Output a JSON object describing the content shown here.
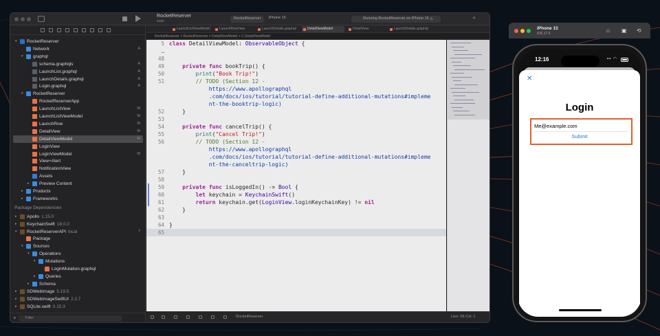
{
  "xcode": {
    "project_name": "RocketReserver",
    "branch": "main",
    "scheme": "RocketReserver",
    "device": "iPhone 15",
    "status": "Running RocketReserver on iPhone 15",
    "tabs": [
      "LaunchListViewModel",
      "LaunchRowView",
      "LaunchDetails.graphql",
      "DetailViewModel",
      "DetailView",
      "LaunchDetails.graphql"
    ],
    "jumpbar": "RocketReserver > RocketReserver > DetailViewModel > C DetailViewModel",
    "navigator": [
      {
        "label": "RocketReserver",
        "indent": 0,
        "icon": "proj",
        "disclosure": "▾"
      },
      {
        "label": "Network",
        "indent": 1,
        "icon": "folder",
        "tag": "A"
      },
      {
        "label": "graphql",
        "indent": 1,
        "icon": "folder",
        "disclosure": "▾"
      },
      {
        "label": "schema.graphqls",
        "indent": 2,
        "icon": "graph",
        "tag": "A"
      },
      {
        "label": "LaunchList.graphql",
        "indent": 2,
        "icon": "graph",
        "tag": "A"
      },
      {
        "label": "LaunchDetails.graphql",
        "indent": 2,
        "icon": "graph",
        "tag": "A"
      },
      {
        "label": "Login.graphql",
        "indent": 2,
        "icon": "graph",
        "tag": "A"
      },
      {
        "label": "RocketReserver",
        "indent": 1,
        "icon": "folder",
        "disclosure": "▾"
      },
      {
        "label": "RocketReserverApp",
        "indent": 2,
        "icon": "swift"
      },
      {
        "label": "LaunchListView",
        "indent": 2,
        "icon": "swift",
        "tag": "M"
      },
      {
        "label": "LaunchListViewModel",
        "indent": 2,
        "icon": "swift",
        "tag": "M"
      },
      {
        "label": "LaunchRow",
        "indent": 2,
        "icon": "swift",
        "tag": "M"
      },
      {
        "label": "DetailView",
        "indent": 2,
        "icon": "swift",
        "tag": "M"
      },
      {
        "label": "DetailViewModel",
        "indent": 2,
        "icon": "swift",
        "tag": "M",
        "selected": true
      },
      {
        "label": "LoginView",
        "indent": 2,
        "icon": "swift"
      },
      {
        "label": "LoginViewModel",
        "indent": 2,
        "icon": "swift",
        "tag": "M"
      },
      {
        "label": "View+Alert",
        "indent": 2,
        "icon": "swift"
      },
      {
        "label": "NotificationView",
        "indent": 2,
        "icon": "swift"
      },
      {
        "label": "Assets",
        "indent": 2,
        "icon": "asset"
      },
      {
        "label": "Preview Content",
        "indent": 2,
        "icon": "folder",
        "disclosure": "▸"
      },
      {
        "label": "Products",
        "indent": 1,
        "icon": "folder",
        "disclosure": "▸"
      },
      {
        "label": "Frameworks",
        "indent": 1,
        "icon": "folder",
        "disclosure": "▸"
      }
    ],
    "package_header": "Package Dependencies",
    "packages": [
      {
        "label": "Apollo",
        "version": "1.15.0",
        "indent": 0,
        "icon": "pkg",
        "disclosure": "▸"
      },
      {
        "label": "KeychainSwift",
        "version": "18.0.0",
        "indent": 0,
        "icon": "pkg",
        "disclosure": "▸"
      },
      {
        "label": "RocketReserverAPI",
        "version": "local",
        "indent": 0,
        "icon": "pkg",
        "disclosure": "▾",
        "tag": "?"
      },
      {
        "label": "Package",
        "indent": 1,
        "icon": "swift"
      },
      {
        "label": "Sources",
        "indent": 1,
        "icon": "folder",
        "disclosure": "▾"
      },
      {
        "label": "Operations",
        "indent": 2,
        "icon": "folder",
        "disclosure": "▾"
      },
      {
        "label": "Mutations",
        "indent": 3,
        "icon": "folder",
        "disclosure": "▾"
      },
      {
        "label": "LoginMutation.graphql",
        "indent": 4,
        "icon": "swift"
      },
      {
        "label": "Queries",
        "indent": 3,
        "icon": "folder",
        "disclosure": "▸"
      },
      {
        "label": "Schema",
        "indent": 2,
        "icon": "folder",
        "disclosure": "▸"
      },
      {
        "label": "SDWebImage",
        "version": "5.19.5",
        "indent": 0,
        "icon": "pkg",
        "disclosure": "▸"
      },
      {
        "label": "SDWebImageSwiftUI",
        "version": "2.2.7",
        "indent": 0,
        "icon": "pkg",
        "disclosure": "▸"
      },
      {
        "label": "SQLite.swift",
        "version": "0.15.3",
        "indent": 0,
        "icon": "pkg",
        "disclosure": "▸"
      }
    ],
    "filter_placeholder": "Filter",
    "code": [
      {
        "n": "5",
        "t": "class DetailViewModel: ObservableObject {",
        "cls": "decl"
      },
      {
        "n": "…",
        "t": "",
        "cls": "plain"
      },
      {
        "n": "48",
        "t": "",
        "cls": "plain"
      },
      {
        "n": "49",
        "t": "    private func bookTrip() {",
        "cls": "fdecl"
      },
      {
        "n": "50",
        "t": "        print(\"Book Trip!\")",
        "cls": "print"
      },
      {
        "n": "51",
        "t": "        // TODO (Section 12 -",
        "cls": "comment"
      },
      {
        "n": "",
        "t": "            https://www.apollographql",
        "cls": "link"
      },
      {
        "n": "",
        "t": "            .com/docs/ios/tutorial/tutorial-define-additional-mutations#impleme",
        "cls": "link"
      },
      {
        "n": "",
        "t": "            nt-the-booktrip-logic)",
        "cls": "link"
      },
      {
        "n": "52",
        "t": "    }",
        "cls": "plain"
      },
      {
        "n": "53",
        "t": "",
        "cls": "plain"
      },
      {
        "n": "54",
        "t": "    private func cancelTrip() {",
        "cls": "fdecl"
      },
      {
        "n": "55",
        "t": "        print(\"Cancel Trip!\")",
        "cls": "print"
      },
      {
        "n": "56",
        "t": "        // TODO (Section 12 -",
        "cls": "comment"
      },
      {
        "n": "",
        "t": "            https://www.apollographql",
        "cls": "link"
      },
      {
        "n": "",
        "t": "            .com/docs/ios/tutorial/tutorial-define-additional-mutations#impleme",
        "cls": "link"
      },
      {
        "n": "",
        "t": "            nt-the-canceltrip-logic)",
        "cls": "link"
      },
      {
        "n": "57",
        "t": "    }",
        "cls": "plain"
      },
      {
        "n": "58",
        "t": "",
        "cls": "plain"
      },
      {
        "n": "59",
        "t": "    private func isLoggedIn() -> Bool {",
        "cls": "fdecl"
      },
      {
        "n": "60",
        "t": "        let keychain = KeychainSwift()",
        "cls": "let"
      },
      {
        "n": "61",
        "t": "        return keychain.get(LoginView.loginKeychainKey) != nil",
        "cls": "ret"
      },
      {
        "n": "62",
        "t": "    }",
        "cls": "plain"
      },
      {
        "n": "63",
        "t": "",
        "cls": "plain"
      },
      {
        "n": "64",
        "t": "}",
        "cls": "plain"
      },
      {
        "n": "65",
        "t": "",
        "cls": "current"
      }
    ],
    "status_line": "Line: 65  Col: 1"
  },
  "simulator": {
    "device_name": "iPhone 15",
    "os": "iOS 17.5",
    "time": "12:16",
    "close_glyph": "✕",
    "login_title": "Login",
    "email_value": "Me@example.com",
    "submit_label": "Submit"
  }
}
